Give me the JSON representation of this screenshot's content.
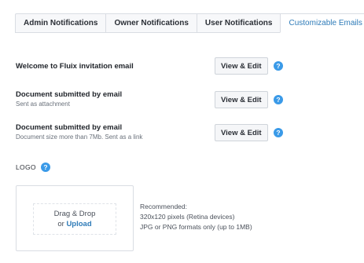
{
  "tabs": [
    {
      "label": "Admin Notifications"
    },
    {
      "label": "Owner Notifications"
    },
    {
      "label": "User Notifications"
    },
    {
      "label": "Customizable Emails"
    }
  ],
  "rows": [
    {
      "title": "Welcome to Fluix invitation email",
      "subtitle": "",
      "button": "View & Edit",
      "help": "?"
    },
    {
      "title": "Document submitted by email",
      "subtitle": "Sent as attachment",
      "button": "View & Edit",
      "help": "?"
    },
    {
      "title": "Document submitted by email",
      "subtitle": "Document size more than 7Mb. Sent as a link",
      "button": "View & Edit",
      "help": "?"
    }
  ],
  "logo": {
    "label": "LOGO",
    "help": "?",
    "drop_text": "Drag & Drop",
    "or_text": "or",
    "upload_text": "Upload",
    "recommend_title": "Recommended:",
    "recommend_size": "320x120 pixels (Retina devices)",
    "recommend_format": "JPG or PNG formats only (up to 1MB)"
  },
  "colors": {
    "accent": "#3a9ae8",
    "link": "#2e7bb8"
  }
}
